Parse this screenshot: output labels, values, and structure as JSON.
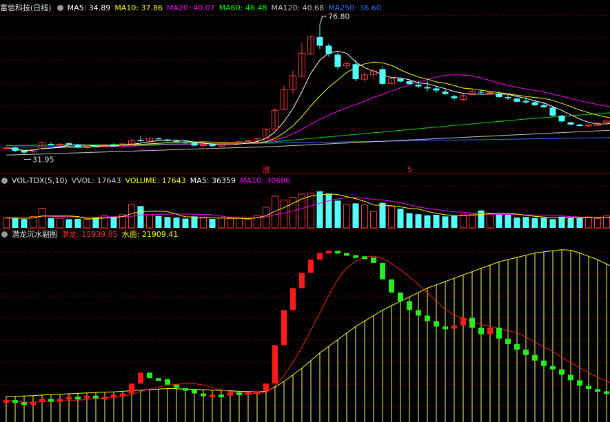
{
  "price_panel": {
    "title": "富信科技(日线)",
    "ma_labels": [
      {
        "text": "MA5: 34.89",
        "color": "#ffffff"
      },
      {
        "text": "MA10: 37.86",
        "color": "#ffff00"
      },
      {
        "text": "MA20: 40.07",
        "color": "#ff00ff"
      },
      {
        "text": "MA60: 46.48",
        "color": "#00ff00"
      },
      {
        "text": "MA120: 40.68",
        "color": "#c0c0c0"
      },
      {
        "text": "MA250: 36.60",
        "color": "#3f6cff"
      }
    ],
    "high_label": "76.80",
    "low_label": "31.95",
    "marker_zhang": "涨",
    "marker_s": "S"
  },
  "volume_panel": {
    "title": "VOL-TDX(5,10)",
    "labels": [
      {
        "text": "VVOL: 17643",
        "color": "#cccccc"
      },
      {
        "text": "VOLUME: 17643",
        "color": "#ffff00"
      },
      {
        "text": "MA5: 36359",
        "color": "#ffffff"
      },
      {
        "text": "MA10: 30686",
        "color": "#ff00ff"
      }
    ]
  },
  "indicator_panel": {
    "title": "潜龙沉水副图",
    "labels": [
      {
        "text": "潜龙: 15939.85",
        "color": "#ff3030"
      },
      {
        "text": "水面: 21909.41",
        "color": "#ffff00"
      }
    ]
  },
  "colors": {
    "up": "#ff3a3a",
    "down": "#54ffff",
    "grid": "#7a0000",
    "bg": "#000000"
  },
  "chart_data": {
    "type": "candlestick",
    "title": "富信科技(日线)",
    "ohlc": [
      [
        33.8,
        34.3,
        33.2,
        34.0
      ],
      [
        34.1,
        34.4,
        32.5,
        33.0
      ],
      [
        33.0,
        33.3,
        31.95,
        32.4
      ],
      [
        32.6,
        33.6,
        32.4,
        33.5
      ],
      [
        33.6,
        36.2,
        33.4,
        35.8
      ],
      [
        35.4,
        35.9,
        34.8,
        35.0
      ],
      [
        35.0,
        35.7,
        34.6,
        35.3
      ],
      [
        35.6,
        36.0,
        35.0,
        35.2
      ],
      [
        35.2,
        35.4,
        33.9,
        34.1
      ],
      [
        34.1,
        34.9,
        33.6,
        34.8
      ],
      [
        34.8,
        35.2,
        34.3,
        34.5
      ],
      [
        34.5,
        35.3,
        34.4,
        35.1
      ],
      [
        35.1,
        35.6,
        34.7,
        34.8
      ],
      [
        34.8,
        35.5,
        34.6,
        35.4
      ],
      [
        35.4,
        37.2,
        35.1,
        36.6
      ],
      [
        36.8,
        38.2,
        36.1,
        36.4
      ],
      [
        36.4,
        37.6,
        36.1,
        37.3
      ],
      [
        37.3,
        37.7,
        36.8,
        37.0
      ],
      [
        36.9,
        37.1,
        36.2,
        36.4
      ],
      [
        36.4,
        36.9,
        35.9,
        36.1
      ],
      [
        36.2,
        36.7,
        35.5,
        35.8
      ],
      [
        35.8,
        36.3,
        34.5,
        34.8
      ],
      [
        34.8,
        35.5,
        34.1,
        35.2
      ],
      [
        35.1,
        35.6,
        34.4,
        34.6
      ],
      [
        34.6,
        35.5,
        34.4,
        35.3
      ],
      [
        35.2,
        36.0,
        35.0,
        35.6
      ],
      [
        35.6,
        36.3,
        35.4,
        36.2
      ],
      [
        36.2,
        36.8,
        36.1,
        36.6
      ],
      [
        36.6,
        37.5,
        36.4,
        37.3
      ],
      [
        37.3,
        40.8,
        37.1,
        40.5
      ],
      [
        40.5,
        47.8,
        40.3,
        47.0
      ],
      [
        47.3,
        55.6,
        47.1,
        54.2
      ],
      [
        54.2,
        60.8,
        52.6,
        59.0
      ],
      [
        58.8,
        70.4,
        58.4,
        66.8
      ],
      [
        66.6,
        72.8,
        66.2,
        72.6
      ],
      [
        72.4,
        76.8,
        68.3,
        69.4
      ],
      [
        69.4,
        70.2,
        65.6,
        66.6
      ],
      [
        66.3,
        67.0,
        61.2,
        62.1
      ],
      [
        62.4,
        64.0,
        61.4,
        63.2
      ],
      [
        63.0,
        64.6,
        57.1,
        57.8
      ],
      [
        57.8,
        60.3,
        57.0,
        59.3
      ],
      [
        59.4,
        61.4,
        57.8,
        60.6
      ],
      [
        61.3,
        62.3,
        55.6,
        56.2
      ],
      [
        56.3,
        58.7,
        56.1,
        58.1
      ],
      [
        57.9,
        58.3,
        56.7,
        57.0
      ],
      [
        57.1,
        57.7,
        55.9,
        56.1
      ],
      [
        55.9,
        57.3,
        54.7,
        55.3
      ],
      [
        55.1,
        57.3,
        53.5,
        54.6
      ],
      [
        54.6,
        55.5,
        53.1,
        53.9
      ],
      [
        53.5,
        54.6,
        52.4,
        52.7
      ],
      [
        51.9,
        52.3,
        50.6,
        51.2
      ],
      [
        50.8,
        52.7,
        50.1,
        52.1
      ],
      [
        52.4,
        54.2,
        52.2,
        53.6
      ],
      [
        53.4,
        54.4,
        52.6,
        53.2
      ],
      [
        52.9,
        53.4,
        52.3,
        53.2
      ],
      [
        52.7,
        53.6,
        51.3,
        51.6
      ],
      [
        51.6,
        52.6,
        50.7,
        51.2
      ],
      [
        51.1,
        51.3,
        49.8,
        50.0
      ],
      [
        50.3,
        51.7,
        49.3,
        49.8
      ],
      [
        49.8,
        50.6,
        48.5,
        48.8
      ],
      [
        48.8,
        49.9,
        47.9,
        48.1
      ],
      [
        48.0,
        48.4,
        44.9,
        45.2
      ],
      [
        45.2,
        45.4,
        42.6,
        43.2
      ],
      [
        42.9,
        43.1,
        41.8,
        42.1
      ],
      [
        42.1,
        42.4,
        41.4,
        41.6
      ],
      [
        41.6,
        42.3,
        41.3,
        42.0
      ],
      [
        41.8,
        42.9,
        41.6,
        42.6
      ],
      [
        42.8,
        43.5,
        42.4,
        43.3
      ],
      [
        43.1,
        44.5,
        42.7,
        44.0
      ]
    ],
    "volume": [
      18000,
      18500,
      16000,
      21000,
      36000,
      18000,
      17500,
      16000,
      16500,
      15000,
      20000,
      23000,
      21000,
      24000,
      43000,
      40000,
      24000,
      22000,
      20000,
      19000,
      17000,
      21000,
      18000,
      16500,
      18000,
      17000,
      18000,
      16000,
      23000,
      38000,
      58000,
      51000,
      56000,
      62000,
      64000,
      67000,
      63000,
      50000,
      43000,
      45000,
      42000,
      30000,
      46000,
      40000,
      35000,
      27000,
      25000,
      23000,
      24000,
      21000,
      22000,
      24000,
      25000,
      32000,
      27000,
      25000,
      24000,
      19000,
      20000,
      18000,
      18500,
      16000,
      20500,
      19000,
      18000,
      20000,
      17000,
      22000,
      23000
    ],
    "qianlong": [
      9000,
      8800,
      8600,
      8800,
      9100,
      8900,
      9100,
      9300,
      9200,
      9400,
      9200,
      9300,
      9500,
      9600,
      10500,
      11500,
      11000,
      10900,
      10400,
      10100,
      10000,
      9600,
      9500,
      9500,
      9400,
      9700,
      9600,
      9700,
      9800,
      10500,
      14000,
      17200,
      19200,
      20600,
      21800,
      22400,
      22600,
      22400,
      22200,
      22100,
      22000,
      21500,
      20000,
      18800,
      18000,
      17200,
      16700,
      16200,
      15700,
      15500,
      15800,
      16500,
      15600,
      15000,
      15600,
      14600,
      14100,
      13600,
      13100,
      12600,
      12100,
      11800,
      11300,
      10800,
      10300,
      10000,
      9800,
      9600,
      9800
    ],
    "shuimian": [
      9300,
      9340,
      9370,
      9400,
      9450,
      9490,
      9530,
      9570,
      9610,
      9650,
      9690,
      9720,
      9750,
      9800,
      9850,
      9900,
      9950,
      10000,
      10050,
      10030,
      10000,
      9980,
      9950,
      9900,
      9880,
      9850,
      9800,
      9780,
      9760,
      9800,
      10200,
      10700,
      11300,
      11900,
      12600,
      13300,
      13900,
      14500,
      15100,
      15700,
      16200,
      16700,
      17200,
      17600,
      18000,
      18400,
      18800,
      19200,
      19500,
      19800,
      20100,
      20400,
      20700,
      21000,
      21300,
      21600,
      21800,
      22000,
      22200,
      22400,
      22500,
      22600,
      22700,
      22650,
      22400,
      22100,
      21800,
      21400,
      21000
    ]
  }
}
